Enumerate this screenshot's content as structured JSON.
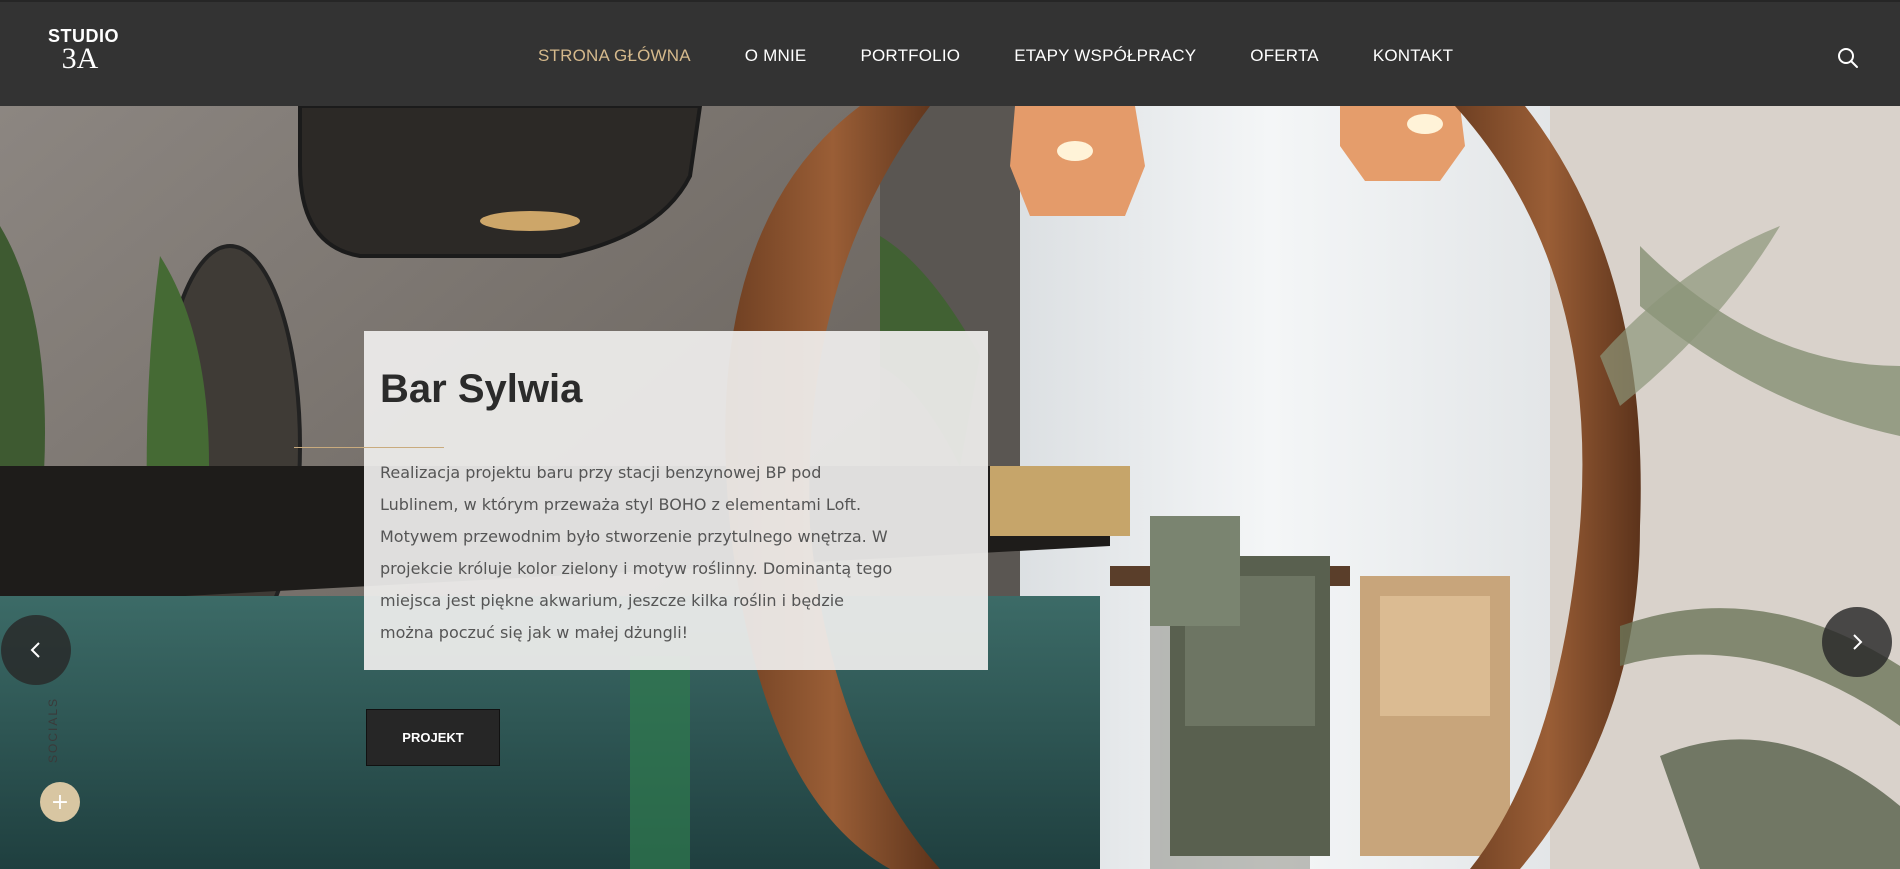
{
  "brand": {
    "line1": "STUDIO",
    "line2": "3A"
  },
  "nav": {
    "items": [
      {
        "label": "STRONA GŁÓWNA",
        "active": true
      },
      {
        "label": "O MNIE",
        "active": false
      },
      {
        "label": "PORTFOLIO",
        "active": false
      },
      {
        "label": "ETAPY WSPÓŁPRACY",
        "active": false
      },
      {
        "label": "OFERTA",
        "active": false
      },
      {
        "label": "KONTAKT",
        "active": false
      }
    ],
    "search_icon": "search-icon"
  },
  "slide": {
    "title": "Bar Sylwia",
    "description": "Realizacja projektu baru przy stacji benzynowej BP pod Lublinem, w którym przeważa styl BOHO z elementami Loft. Motywem przewodnim było stworzenie przytulnego wnętrza. W projekcie króluje kolor zielony i motyw roślinny. Dominantą tego miejsca jest piękne akwarium, jeszcze kilka roślin i będzie można poczuć się jak w małej dżungli!",
    "button_label": "PROJEKT"
  },
  "controls": {
    "prev_icon": "chevron-left-icon",
    "next_icon": "chevron-right-icon",
    "socials_label": "SOCIALS",
    "plus_label": "+"
  },
  "colors": {
    "header_bg": "#333333",
    "accent_gold": "#d5b98c",
    "button_bg": "#262626"
  }
}
